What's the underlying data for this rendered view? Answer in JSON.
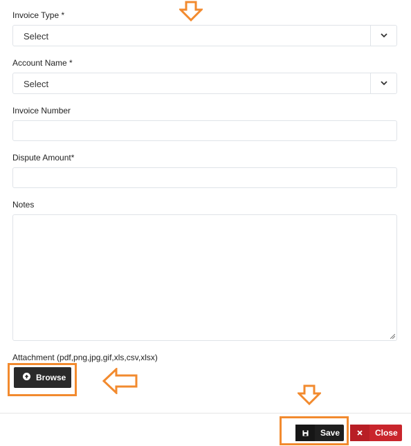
{
  "form": {
    "invoice_type": {
      "label": "Invoice Type *",
      "value": "Select"
    },
    "account_name": {
      "label": "Account Name *",
      "value": "Select"
    },
    "invoice_number": {
      "label": "Invoice Number",
      "value": ""
    },
    "dispute_amount": {
      "label": "Dispute Amount*",
      "value": ""
    },
    "notes": {
      "label": "Notes",
      "value": ""
    },
    "attachment": {
      "label": "Attachment (pdf,png,jpg,gif,xls,csv,xlsx)",
      "browse_label": "Browse"
    }
  },
  "footer": {
    "save_label": "Save",
    "close_label": "Close"
  },
  "colors": {
    "annotation": "#f28a2e",
    "close_button": "#c9252c",
    "dark_button": "#2a2a2a"
  },
  "icons": {
    "caret": "chevron-down-icon",
    "upload": "upload-icon",
    "save": "floppy-disk-icon",
    "close": "close-icon",
    "annotation_arrow": "arrow-icon"
  }
}
